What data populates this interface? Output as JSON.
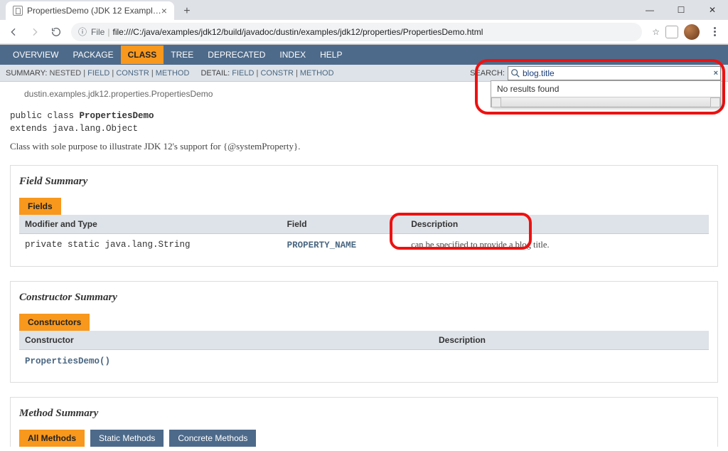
{
  "browser": {
    "tab_title": "PropertiesDemo (JDK 12 Exampl…",
    "url_label": "File",
    "url": "file:///C:/java/examples/jdk12/build/javadoc/dustin/examples/jdk12/properties/PropertiesDemo.html"
  },
  "topnav": {
    "items": [
      "OVERVIEW",
      "PACKAGE",
      "CLASS",
      "TREE",
      "DEPRECATED",
      "INDEX",
      "HELP"
    ],
    "active_index": 2
  },
  "subnav": {
    "summary_label": "SUMMARY:",
    "summary_items": [
      "NESTED",
      "FIELD",
      "CONSTR",
      "METHOD"
    ],
    "detail_label": "DETAIL:",
    "detail_items": [
      "FIELD",
      "CONSTR",
      "METHOD"
    ],
    "search_label": "SEARCH:",
    "search_value": "blog.title",
    "search_result_msg": "No results found"
  },
  "header": {
    "breadcrumb": "dustin.examples.jdk12.properties.PropertiesDemo",
    "decl_line1_pre": "public class ",
    "decl_line1_name": "PropertiesDemo",
    "decl_line2": "extends java.lang.Object",
    "description": "Class with sole purpose to illustrate JDK 12's support for {@systemProperty}."
  },
  "fields": {
    "section_title": "Field Summary",
    "tab_label": "Fields",
    "cols": [
      "Modifier and Type",
      "Field",
      "Description"
    ],
    "rows": [
      {
        "mod": "private static java.lang.String",
        "name": "PROPERTY_NAME",
        "desc": "can be specified to provide a blog title."
      }
    ]
  },
  "constructors": {
    "section_title": "Constructor Summary",
    "tab_label": "Constructors",
    "cols": [
      "Constructor",
      "Description"
    ],
    "rows": [
      {
        "name": "PropertiesDemo()",
        "desc": ""
      }
    ]
  },
  "methods": {
    "section_title": "Method Summary",
    "tabs": [
      "All Methods",
      "Static Methods",
      "Concrete Methods"
    ]
  }
}
